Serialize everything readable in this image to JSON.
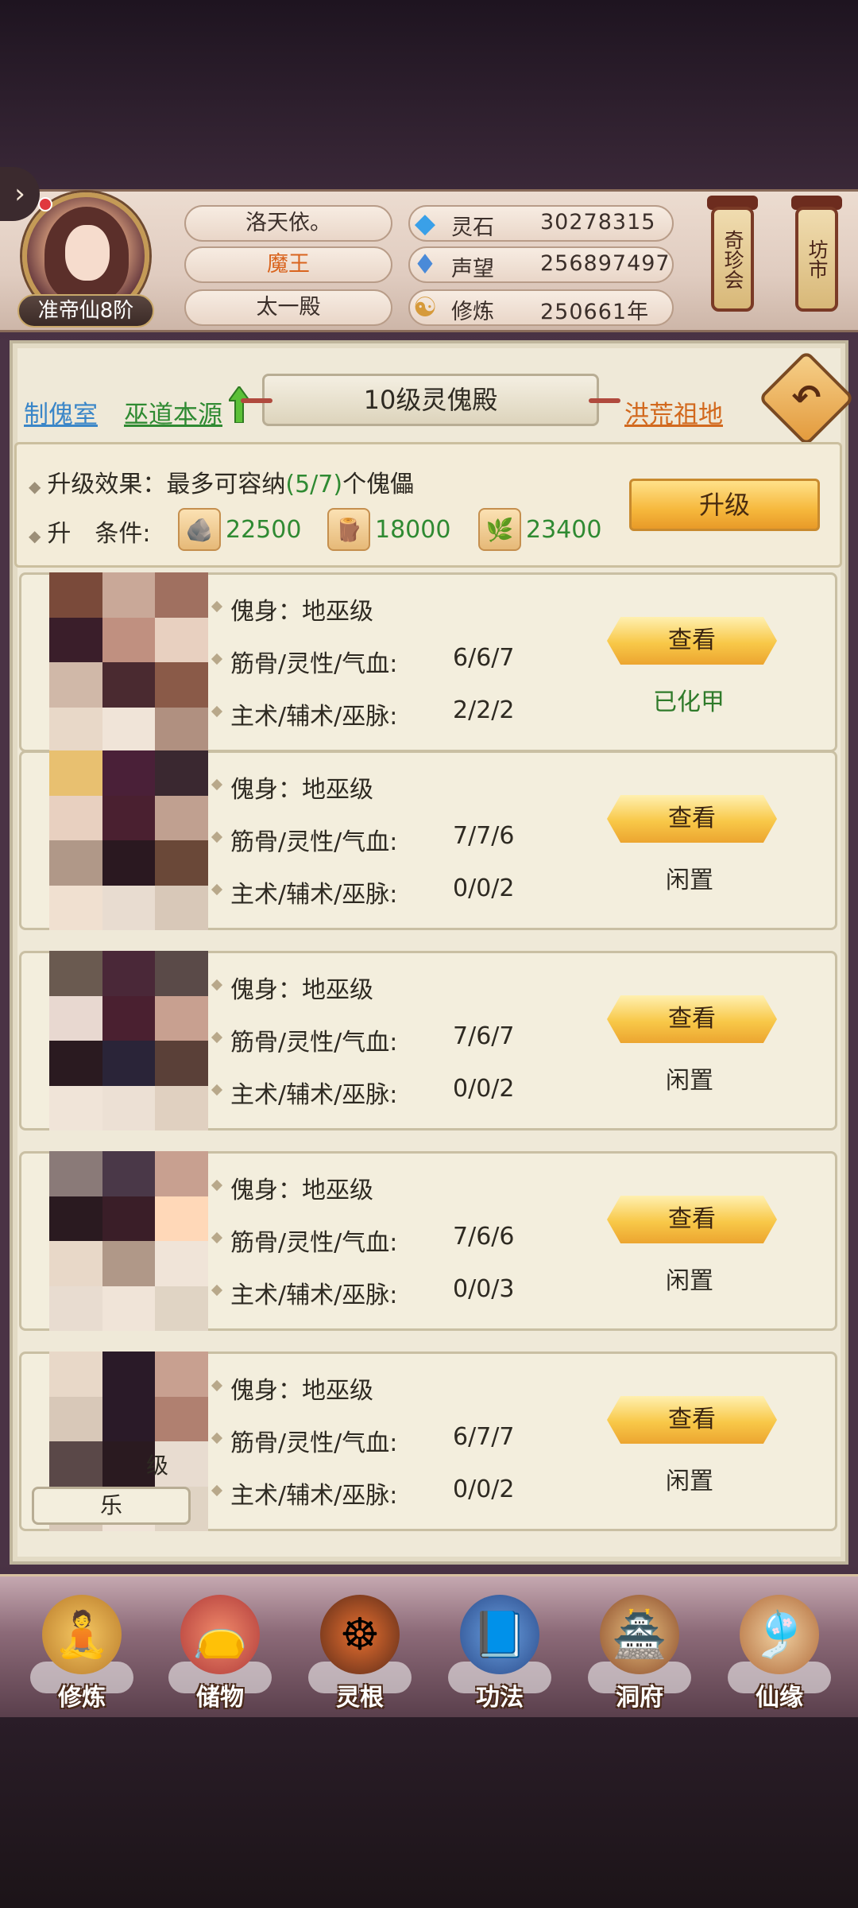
{
  "player": {
    "name": "洛天依。",
    "title": "魔王",
    "sect": "太一殿",
    "rank": "准帝仙8阶"
  },
  "resources": [
    {
      "label": "灵石",
      "value": "30278315",
      "icon": "spirit-stone-icon"
    },
    {
      "label": "声望",
      "value": "256897497",
      "icon": "reputation-icon"
    },
    {
      "label": "修炼",
      "value": "250661年",
      "icon": "cultivation-icon"
    }
  ],
  "top_buttons": {
    "treasure": "奇珍会",
    "market": "坊市"
  },
  "page": {
    "title": "10级灵傀殿",
    "link_left1": "制傀室",
    "link_left2": "巫道本源",
    "link_right": "洪荒祖地"
  },
  "upgrade": {
    "effect_label": "升级效果：",
    "effect_text_a": "最多可容纳",
    "effect_capacity": "(5/7)",
    "effect_text_b": "个傀儡",
    "cond_label": "升　条件:",
    "costs": [
      {
        "icon": "ore-icon",
        "value": "22500"
      },
      {
        "icon": "wood-icon",
        "value": "18000"
      },
      {
        "icon": "herb-icon",
        "value": "23400"
      }
    ],
    "button": "升级"
  },
  "puppets": [
    {
      "body": "傀身：地巫级",
      "stats_label": "筋骨/灵性/气血:",
      "stats": "6/6/7",
      "skills_label": "主术/辅术/巫脉:",
      "skills": "2/2/2",
      "view": "查看",
      "status": "已化甲",
      "status_color": "#2f7a2a"
    },
    {
      "body": "傀身：地巫级",
      "stats_label": "筋骨/灵性/气血:",
      "stats": "7/7/6",
      "skills_label": "主术/辅术/巫脉:",
      "skills": "0/0/2",
      "view": "查看",
      "status": "闲置",
      "status_color": "#2e2a22"
    },
    {
      "body": "傀身：地巫级",
      "stats_label": "筋骨/灵性/气血:",
      "stats": "7/6/7",
      "skills_label": "主术/辅术/巫脉:",
      "skills": "0/0/2",
      "view": "查看",
      "status": "闲置",
      "status_color": "#2e2a22"
    },
    {
      "body": "傀身：地巫级",
      "stats_label": "筋骨/灵性/气血:",
      "stats": "7/6/6",
      "skills_label": "主术/辅术/巫脉:",
      "skills": "0/0/3",
      "view": "查看",
      "status": "闲置",
      "status_color": "#2e2a22"
    },
    {
      "body": "傀身：地巫级",
      "stats_label": "筋骨/灵性/气血:",
      "stats": "6/7/7",
      "skills_label": "主术/辅术/巫脉:",
      "skills": "0/0/2",
      "view": "查看",
      "status": "闲置",
      "status_color": "#2e2a22",
      "portrait_caption": "乐",
      "portrait_tag": "级"
    }
  ],
  "bottom_nav": [
    {
      "label": "修炼",
      "icon": "meditating-monk-icon"
    },
    {
      "label": "储物",
      "icon": "treasure-bag-icon"
    },
    {
      "label": "灵根",
      "icon": "spirit-root-icon"
    },
    {
      "label": "功法",
      "icon": "scripture-book-icon"
    },
    {
      "label": "洞府",
      "icon": "cave-mansion-icon"
    },
    {
      "label": "仙缘",
      "icon": "gourd-icon"
    }
  ],
  "colors": {
    "link_blue": "#3a86c8",
    "link_green": "#2f8a32",
    "link_orange": "#d2691e",
    "gold": "#f6b83c"
  }
}
